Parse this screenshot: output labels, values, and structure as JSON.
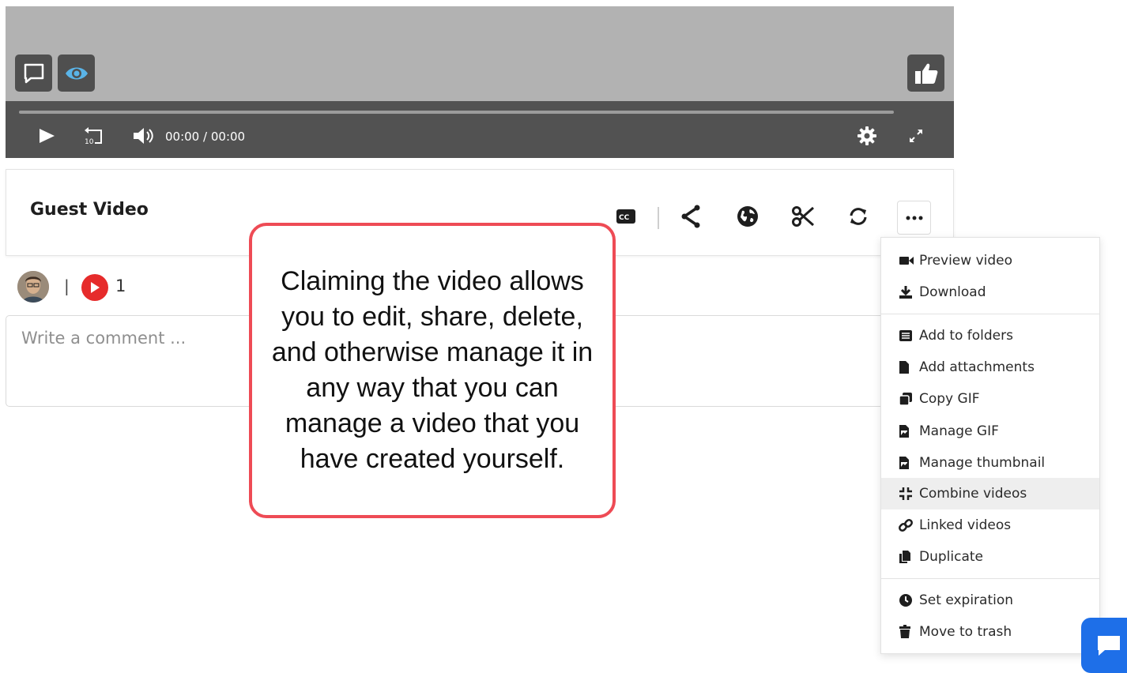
{
  "player": {
    "time_current": "00:00",
    "time_separator": "/",
    "time_total": "00:00",
    "progress_fraction": 0.0,
    "overlay_icons": [
      "comment-icon",
      "eye-icon",
      "thumbs-up-icon"
    ],
    "control_icons": [
      "play-icon",
      "rewind-10-icon",
      "volume-icon",
      "gear-icon",
      "fullscreen-icon"
    ]
  },
  "video": {
    "title": "Guest Video",
    "toolbar_icons": [
      "closed-captions-icon",
      "share-icon",
      "globe-icon",
      "scissors-icon",
      "refresh-icon",
      "more-icon"
    ]
  },
  "meta": {
    "separator": "|",
    "view_count": "1"
  },
  "comment": {
    "placeholder": "Write a comment ..."
  },
  "callout": {
    "text": "Claiming the video allows you to edit, share, delete, and otherwise manage it in any way that you can manage a video that you have created yourself.",
    "border_color": "#ee4b55"
  },
  "menu": {
    "items": [
      {
        "label": "Preview video",
        "icon": "video-camera-icon"
      },
      {
        "label": "Download",
        "icon": "download-icon"
      },
      {
        "label": "Add to folders",
        "icon": "list-icon"
      },
      {
        "label": "Add attachments",
        "icon": "file-icon"
      },
      {
        "label": "Copy GIF",
        "icon": "copy-icon"
      },
      {
        "label": "Manage GIF",
        "icon": "image-file-icon"
      },
      {
        "label": "Manage thumbnail",
        "icon": "image-file-icon"
      },
      {
        "label": "Combine videos",
        "icon": "combine-icon"
      },
      {
        "label": "Linked videos",
        "icon": "link-icon"
      },
      {
        "label": "Duplicate",
        "icon": "duplicate-icon"
      },
      {
        "label": "Set expiration",
        "icon": "clock-icon"
      },
      {
        "label": "Move to trash",
        "icon": "trash-icon"
      }
    ],
    "highlighted": "Combine videos"
  },
  "colors": {
    "accent_red": "#e62b2b",
    "chat_blue": "#1e6fe8",
    "eye_blue": "#5ab4e8"
  }
}
